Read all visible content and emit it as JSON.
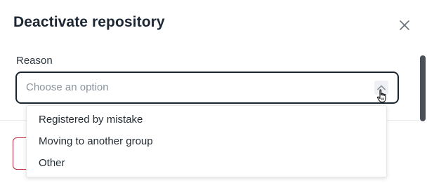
{
  "dialog": {
    "title": "Deactivate repository",
    "close_icon": "close-icon"
  },
  "reason": {
    "label": "Reason",
    "placeholder": "Choose an option",
    "toggle_icon": "chevron-up-icon",
    "options": [
      "Registered by mistake",
      "Moving to another group",
      "Other"
    ]
  },
  "colors": {
    "select_border": "#1c242d",
    "footer_button_border": "#b8283a",
    "scrollbar_thumb": "#4a5058"
  }
}
